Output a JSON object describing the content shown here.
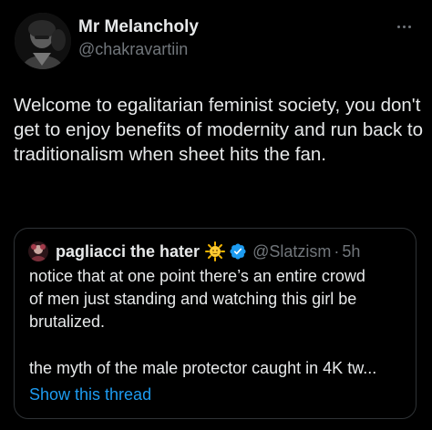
{
  "tweet": {
    "author": {
      "name": "Mr Melancholy",
      "handle": "@chakravartiin"
    },
    "more_icon": "ellipsis-icon",
    "text": "Welcome to egalitarian feminist society, you don't get to enjoy benefits of modernity and run back to traditionalism when sheet hits the fan."
  },
  "quote": {
    "author": {
      "name": "pagliacci the hater",
      "handle": "@Slatzism",
      "separator": "·",
      "time": "5h"
    },
    "icons": [
      "sun-emoji-icon",
      "verified-badge-icon"
    ],
    "verified_color": "#1d9bf0",
    "body_lines": [
      "notice that at one point there’s an entire crowd",
      "of men just standing and watching this girl be",
      "brutalized."
    ],
    "body_para2": "the myth of the male protector caught in 4K tw...",
    "show_thread": "Show this thread"
  },
  "colors": {
    "background": "#000000",
    "text_primary": "#e7e9ea",
    "text_secondary": "#71767b",
    "link": "#1d9bf0",
    "border": "#2f3336"
  }
}
